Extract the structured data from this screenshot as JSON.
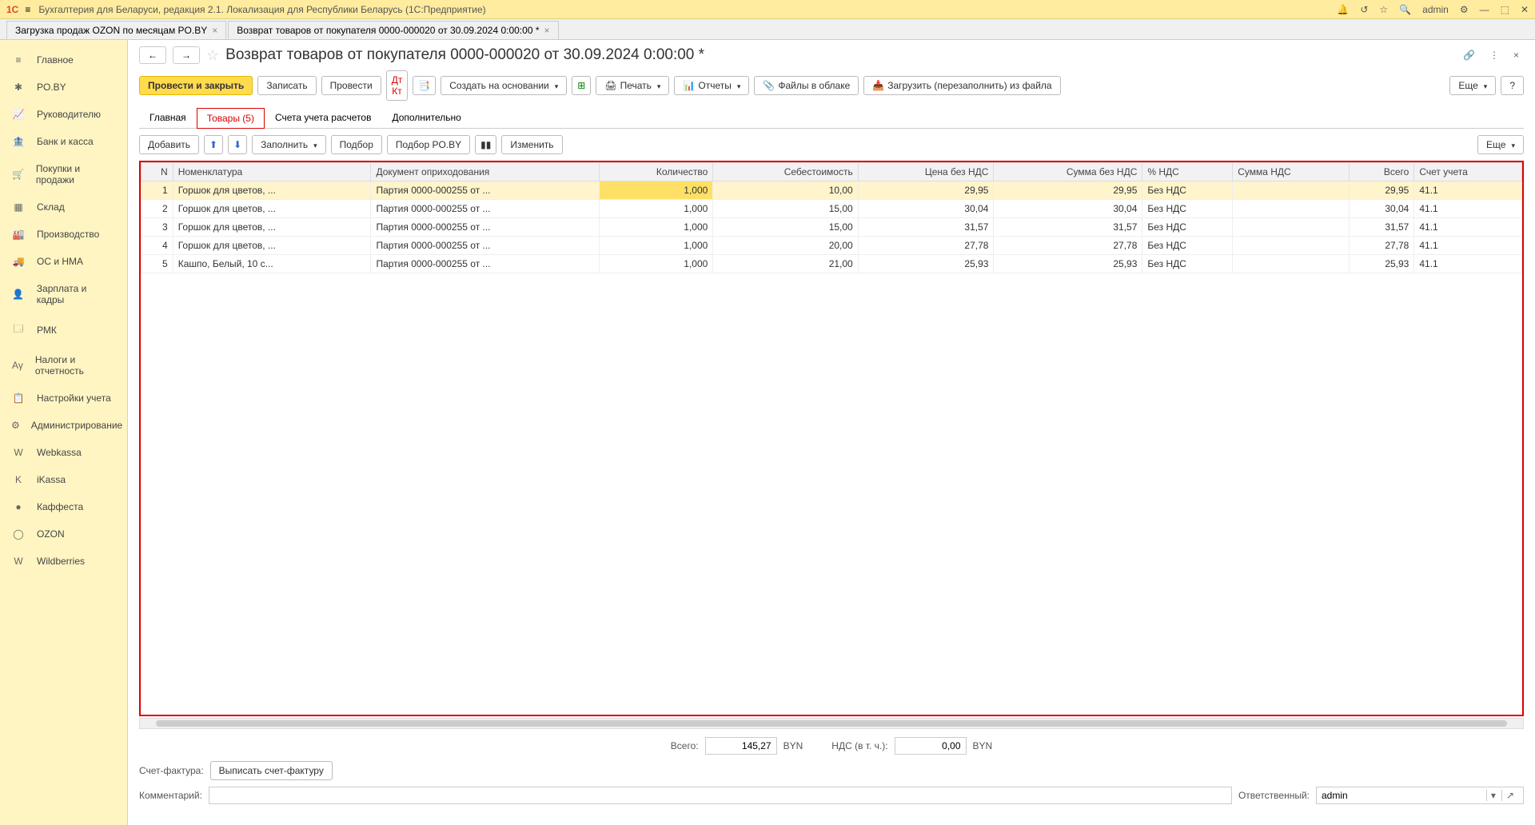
{
  "title": "Бухгалтерия для Беларуси, редакция 2.1. Локализация для Республики Беларусь   (1С:Предприятие)",
  "user": "admin",
  "tabs": [
    {
      "label": "Загрузка продаж OZON по месяцам PO.BY"
    },
    {
      "label": "Возврат товаров от покупателя 0000-000020 от 30.09.2024 0:00:00 *"
    }
  ],
  "sidebar": [
    {
      "label": "Главное",
      "icon": "≡"
    },
    {
      "label": "PO.BY",
      "icon": "✱"
    },
    {
      "label": "Руководителю",
      "icon": "📈"
    },
    {
      "label": "Банк и касса",
      "icon": "🏦"
    },
    {
      "label": "Покупки и продажи",
      "icon": "🛒"
    },
    {
      "label": "Склад",
      "icon": "▦"
    },
    {
      "label": "Производство",
      "icon": "🏭"
    },
    {
      "label": "ОС и НМА",
      "icon": "🚚"
    },
    {
      "label": "Зарплата и кадры",
      "icon": "👤"
    },
    {
      "label": "РМК",
      "icon": "🗔"
    },
    {
      "label": "Налоги и отчетность",
      "icon": "Αγ"
    },
    {
      "label": "Настройки учета",
      "icon": "📋"
    },
    {
      "label": "Администрирование",
      "icon": "⚙"
    },
    {
      "label": "Webkassa",
      "icon": "W"
    },
    {
      "label": "iKassa",
      "icon": "K"
    },
    {
      "label": "Каффеста",
      "icon": "●"
    },
    {
      "label": "OZON",
      "icon": "◯"
    },
    {
      "label": "Wildberries",
      "icon": "W"
    }
  ],
  "page_title": "Возврат товаров от покупателя 0000-000020 от 30.09.2024 0:00:00 *",
  "toolbar": {
    "post_close": "Провести и закрыть",
    "save": "Записать",
    "post": "Провести",
    "create_based": "Создать на основании",
    "print": "Печать",
    "reports": "Отчеты",
    "files_cloud": "Файлы в облаке",
    "load_file": "Загрузить (перезаполнить) из файла",
    "more": "Еще",
    "help": "?"
  },
  "doc_tabs": [
    {
      "label": "Главная"
    },
    {
      "label": "Товары (5)",
      "active": true
    },
    {
      "label": "Счета учета расчетов"
    },
    {
      "label": "Дополнительно"
    }
  ],
  "subtoolbar": {
    "add": "Добавить",
    "fill": "Заполнить",
    "select": "Подбор",
    "select_poby": "Подбор PO.BY",
    "edit": "Изменить",
    "more": "Еще"
  },
  "columns": [
    "N",
    "Номенклатура",
    "Документ оприходования",
    "Количество",
    "Себестоимость",
    "Цена без НДС",
    "Сумма без НДС",
    "% НДС",
    "Сумма НДС",
    "Всего",
    "Счет учета"
  ],
  "rows": [
    {
      "n": 1,
      "nom": "Горшок для цветов, ...",
      "doc": "Партия 0000-000255 от ...",
      "qty": "1,000",
      "cost": "10,00",
      "price": "29,95",
      "sum": "29,95",
      "vat": "Без НДС",
      "vat_sum": "",
      "total": "29,95",
      "acct": "41.1"
    },
    {
      "n": 2,
      "nom": "Горшок для цветов, ...",
      "doc": "Партия 0000-000255 от ...",
      "qty": "1,000",
      "cost": "15,00",
      "price": "30,04",
      "sum": "30,04",
      "vat": "Без НДС",
      "vat_sum": "",
      "total": "30,04",
      "acct": "41.1"
    },
    {
      "n": 3,
      "nom": "Горшок для цветов, ...",
      "doc": "Партия 0000-000255 от ...",
      "qty": "1,000",
      "cost": "15,00",
      "price": "31,57",
      "sum": "31,57",
      "vat": "Без НДС",
      "vat_sum": "",
      "total": "31,57",
      "acct": "41.1"
    },
    {
      "n": 4,
      "nom": "Горшок для цветов, ...",
      "doc": "Партия 0000-000255 от ...",
      "qty": "1,000",
      "cost": "20,00",
      "price": "27,78",
      "sum": "27,78",
      "vat": "Без НДС",
      "vat_sum": "",
      "total": "27,78",
      "acct": "41.1"
    },
    {
      "n": 5,
      "nom": "Кашпо, Белый, 10 с...",
      "doc": "Партия 0000-000255 от ...",
      "qty": "1,000",
      "cost": "21,00",
      "price": "25,93",
      "sum": "25,93",
      "vat": "Без НДС",
      "vat_sum": "",
      "total": "25,93",
      "acct": "41.1"
    }
  ],
  "footer": {
    "total_label": "Всего:",
    "total_value": "145,27",
    "currency": "BYN",
    "vat_label": "НДС (в т. ч.):",
    "vat_value": "0,00",
    "invoice_label": "Счет-фактура:",
    "invoice_btn": "Выписать счет-фактуру",
    "comment_label": "Комментарий:",
    "comment_value": "",
    "responsible_label": "Ответственный:",
    "responsible_value": "admin"
  }
}
